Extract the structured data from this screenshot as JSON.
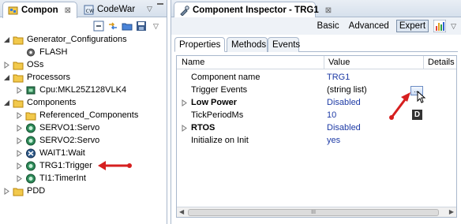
{
  "left_panel": {
    "tabs": [
      {
        "label": "Compon",
        "icon": "components-view-icon",
        "close": "⊠"
      },
      {
        "label": "CodeWar",
        "icon": "codewarrior-icon"
      }
    ],
    "tree": [
      {
        "label": "Generator_Configurations",
        "icon": "folder-icon",
        "level": 0,
        "expanded": true
      },
      {
        "label": "FLASH",
        "icon": "gear-icon",
        "level": 1
      },
      {
        "label": "OSs",
        "icon": "folder-icon",
        "level": 0,
        "expanded": false
      },
      {
        "label": "Processors",
        "icon": "folder-icon",
        "level": 0,
        "expanded": true
      },
      {
        "label": "Cpu:MKL25Z128VLK4",
        "icon": "cpu-icon",
        "level": 1,
        "expanded": false
      },
      {
        "label": "Components",
        "icon": "folder-icon",
        "level": 0,
        "expanded": true
      },
      {
        "label": "Referenced_Components",
        "icon": "folder-icon",
        "level": 1,
        "expanded": false
      },
      {
        "label": "SERVO1:Servo",
        "icon": "component-icon",
        "level": 1,
        "expanded": false
      },
      {
        "label": "SERVO2:Servo",
        "icon": "component-icon",
        "level": 1,
        "expanded": false
      },
      {
        "label": "WAIT1:Wait",
        "icon": "component-wait-icon",
        "level": 1,
        "expanded": false
      },
      {
        "label": "TRG1:Trigger",
        "icon": "component-icon",
        "level": 1,
        "expanded": false
      },
      {
        "label": "TI1:TimerInt",
        "icon": "component-icon",
        "level": 1,
        "expanded": false
      },
      {
        "label": "PDD",
        "icon": "folder-icon",
        "level": 0,
        "expanded": false
      }
    ]
  },
  "inspector": {
    "tab_title": "Component Inspector - TRG1",
    "tab_close": "⊠",
    "modes": [
      "Basic",
      "Advanced",
      "Expert"
    ],
    "active_mode": "Expert",
    "subtabs": [
      "Properties",
      "Methods",
      "Events"
    ],
    "columns": [
      "Name",
      "Value",
      "Details"
    ],
    "rows": [
      {
        "name": "Component name",
        "value": "TRG1",
        "bold": false,
        "expandable": false
      },
      {
        "name": "Trigger Events",
        "value": "(string list)",
        "bold": false,
        "expandable": false
      },
      {
        "name": "Low Power",
        "value": "Disabled",
        "bold": true,
        "expandable": true
      },
      {
        "name": "TickPeriodMs",
        "value": "10",
        "bold": false,
        "expandable": false
      },
      {
        "name": "RTOS",
        "value": "Disabled",
        "bold": true,
        "expandable": true
      },
      {
        "name": "Initialize on Init",
        "value": "yes",
        "bold": false,
        "expandable": false
      }
    ],
    "dots_button": "...",
    "badge": "D",
    "scroll_grip": "III"
  },
  "colors": {
    "value_text": "#1d3aa5",
    "annotation_arrow": "#d61f1f",
    "panel_border": "#a9b8cc"
  }
}
